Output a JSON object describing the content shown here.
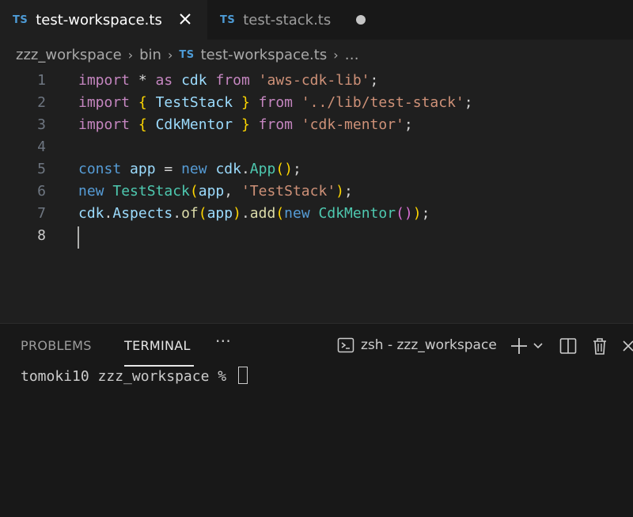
{
  "tabs": [
    {
      "label": "test-workspace.ts",
      "badge": "TS"
    },
    {
      "label": "test-stack.ts",
      "badge": "TS"
    }
  ],
  "breadcrumb": {
    "folder1": "zzz_workspace",
    "folder2": "bin",
    "badge": "TS",
    "file": "test-workspace.ts",
    "more": "…"
  },
  "editor": {
    "line_numbers": [
      "1",
      "2",
      "3",
      "4",
      "5",
      "6",
      "7",
      "8"
    ],
    "current_line": 8
  },
  "panel": {
    "tab_problems": "PROBLEMS",
    "tab_terminal": "TERMINAL",
    "more": "···",
    "terminal_name": "zsh - zzz_workspace",
    "prompt": "tomoki10 zzz_workspace % "
  },
  "colors": {
    "keyword": "#c586c0",
    "class": "#4ec9b0",
    "string": "#ce9178",
    "variable": "#9cdcfe"
  }
}
